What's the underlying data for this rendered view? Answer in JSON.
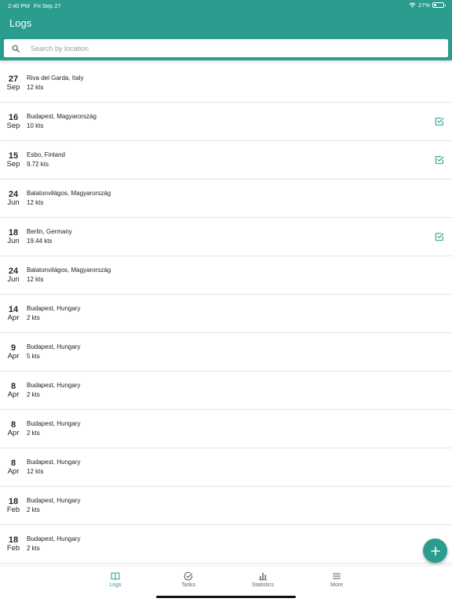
{
  "status_bar": {
    "time": "2:40 PM",
    "date": "Fri Sep 27",
    "battery_percent": "27%",
    "battery_level": 0.27
  },
  "header": {
    "title": "Logs"
  },
  "search": {
    "placeholder": "Search by location",
    "value": ""
  },
  "logs": [
    {
      "day": "27",
      "month": "Sep",
      "location": "Riva del Garda, Italy",
      "speed": "12 kts",
      "checked": false
    },
    {
      "day": "16",
      "month": "Sep",
      "location": "Budapest, Magyarország",
      "speed": "10 kts",
      "checked": true
    },
    {
      "day": "15",
      "month": "Sep",
      "location": "Esbo, Finland",
      "speed": "9.72 kts",
      "checked": true
    },
    {
      "day": "24",
      "month": "Jun",
      "location": "Balatonvilágos, Magyarország",
      "speed": "12 kts",
      "checked": false
    },
    {
      "day": "18",
      "month": "Jun",
      "location": "Berlin, Germany",
      "speed": "19.44 kts",
      "checked": true
    },
    {
      "day": "24",
      "month": "Jun",
      "location": "Balatonvilágos, Magyarország",
      "speed": "12 kts",
      "checked": false
    },
    {
      "day": "14",
      "month": "Apr",
      "location": "Budapest, Hungary",
      "speed": "2 kts",
      "checked": false
    },
    {
      "day": "9",
      "month": "Apr",
      "location": "Budapest, Hungary",
      "speed": "5 kts",
      "checked": false
    },
    {
      "day": "8",
      "month": "Apr",
      "location": "Budapest, Hungary",
      "speed": "2 kts",
      "checked": false
    },
    {
      "day": "8",
      "month": "Apr",
      "location": "Budapest, Hungary",
      "speed": "2 kts",
      "checked": false
    },
    {
      "day": "8",
      "month": "Apr",
      "location": "Budapest, Hungary",
      "speed": "12 kts",
      "checked": false
    },
    {
      "day": "18",
      "month": "Feb",
      "location": "Budapest, Hungary",
      "speed": "2 kts",
      "checked": false
    },
    {
      "day": "18",
      "month": "Feb",
      "location": "Budapest, Hungary",
      "speed": "2 kts",
      "checked": false
    }
  ],
  "fab": {
    "icon": "plus-icon"
  },
  "tabbar": {
    "tabs": [
      {
        "label": "Logs",
        "icon": "book-open-icon",
        "active": true
      },
      {
        "label": "Tasks",
        "icon": "check-circle-icon",
        "active": false
      },
      {
        "label": "Statistics",
        "icon": "bar-chart-icon",
        "active": false
      },
      {
        "label": "More",
        "icon": "menu-icon",
        "active": false
      }
    ]
  },
  "colors": {
    "accent": "#2a9d8f",
    "text": "#222222",
    "divider": "#e5e5e5"
  }
}
